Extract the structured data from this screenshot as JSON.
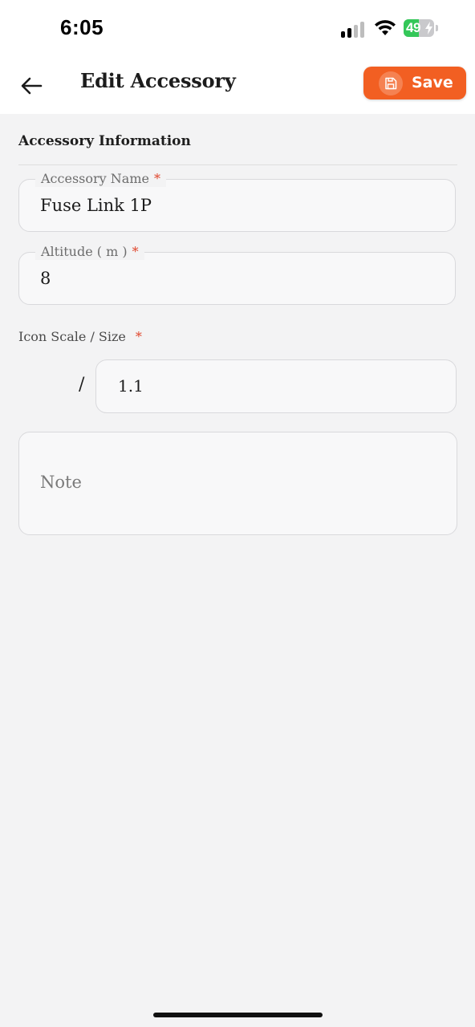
{
  "status_bar": {
    "time": "6:05",
    "battery_level": "49",
    "battery_percent": 49
  },
  "header": {
    "title": "Edit Accessory",
    "back_icon": "arrow-left-icon",
    "save_label": "Save",
    "save_icon": "floppy-disk-icon"
  },
  "section": {
    "title": "Accessory Information"
  },
  "fields": {
    "accessory_name": {
      "label": "Accessory Name",
      "required_mark": "*",
      "value": "Fuse Link 1P"
    },
    "altitude": {
      "label": "Altitude ( m )",
      "required_mark": "*",
      "value": "8"
    },
    "icon_scale": {
      "label": "Icon Scale / Size",
      "required_mark": "*",
      "prefix": "/",
      "value": "1.1"
    },
    "note": {
      "placeholder": "Note",
      "value": ""
    }
  },
  "colors": {
    "accent": "#f25f22",
    "required": "#e0452b",
    "background": "#f3f3f4",
    "battery_green": "#34c759"
  }
}
